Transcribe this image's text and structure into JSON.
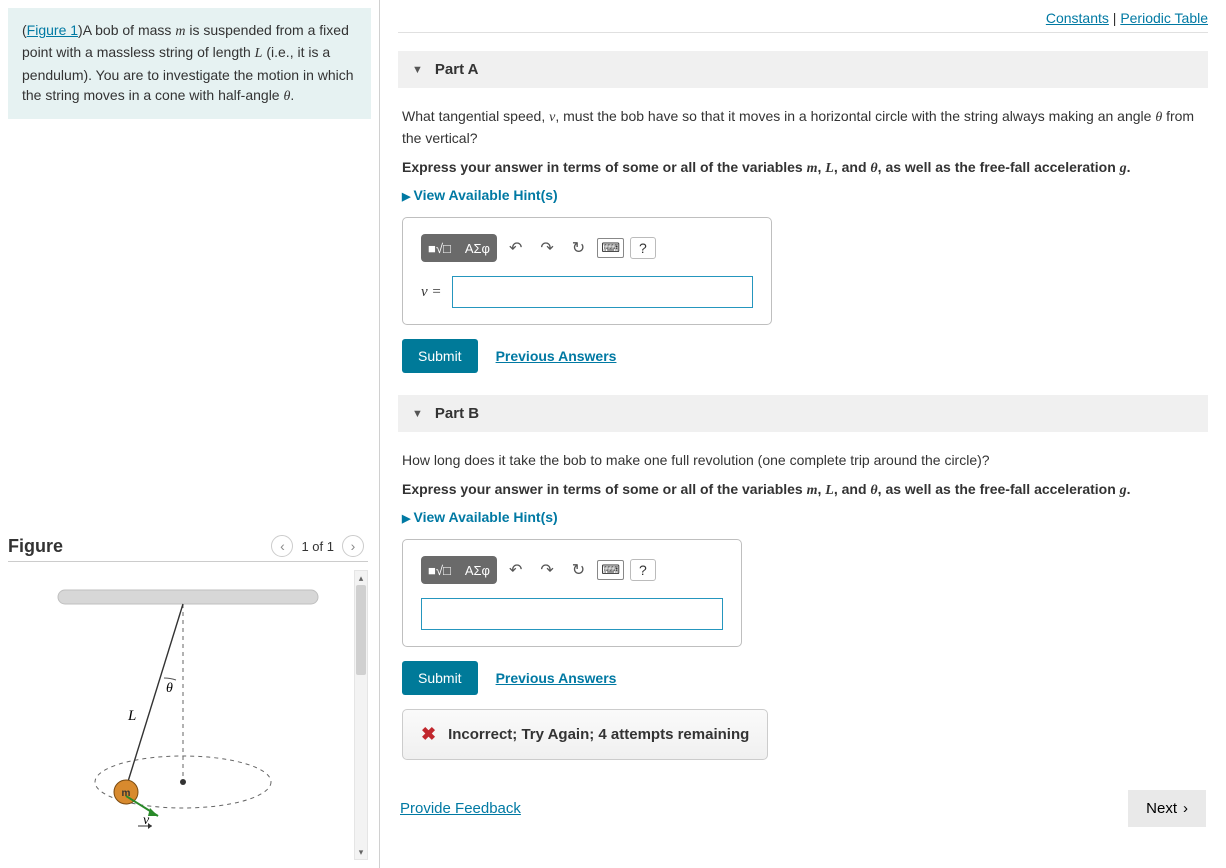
{
  "problem": {
    "figure_link": "Figure 1",
    "text_prefix": "(",
    "text_after_link": ")A bob of mass ",
    "var_m": "m",
    "text_1": " is suspended from a fixed point with a massless string of length ",
    "var_L": "L",
    "text_2": " (i.e., it is a pendulum). You are to investigate the motion in which the string moves in a cone with half-angle ",
    "var_theta": "θ",
    "text_end": "."
  },
  "figure": {
    "heading": "Figure",
    "counter": "1 of 1",
    "labels": {
      "L": "L",
      "theta": "θ",
      "m": "m",
      "v": "v"
    }
  },
  "top_links": {
    "constants": "Constants",
    "sep": " | ",
    "periodic": "Periodic Table"
  },
  "partA": {
    "title": "Part A",
    "question_1": "What tangential speed, ",
    "var_v": "v",
    "question_2": ", must the bob have so that it moves in a horizontal circle with the string always making an angle ",
    "var_theta": "θ",
    "question_3": " from the vertical?",
    "express_1": "Express your answer in terms of some or all of the variables ",
    "ev_m": "m",
    "ev_sep1": ", ",
    "ev_L": "L",
    "ev_sep2": ", and ",
    "ev_th": "θ",
    "express_2": ", as well as the free-fall acceleration ",
    "ev_g": "g",
    "express_end": ".",
    "hints": "View Available Hint(s)",
    "eq_label": "v =",
    "submit": "Submit",
    "prev": "Previous Answers"
  },
  "partB": {
    "title": "Part B",
    "question": "How long does it take the bob to make one full revolution (one complete trip around the circle)?",
    "express_1": "Express your answer in terms of some or all of the variables ",
    "ev_m": "m",
    "ev_sep1": ", ",
    "ev_L": "L",
    "ev_sep2": ", and ",
    "ev_th": "θ",
    "express_2": ", as well as the free-fall acceleration ",
    "ev_g": "g",
    "express_end": ".",
    "hints": "View Available Hint(s)",
    "submit": "Submit",
    "prev": "Previous Answers",
    "feedback": "Incorrect; Try Again; 4 attempts remaining"
  },
  "toolbar": {
    "templates": "■√□",
    "greek": "ΑΣφ",
    "undo": "↶",
    "redo": "↷",
    "reset": "↻",
    "keyboard": "⌨",
    "help": "?"
  },
  "bottom": {
    "feedback": "Provide Feedback",
    "next": "Next"
  }
}
